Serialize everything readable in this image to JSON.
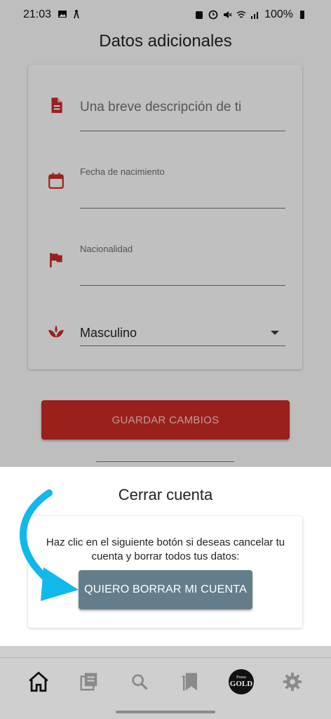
{
  "status_bar": {
    "time": "21:03",
    "battery": "100%",
    "left_icons": [
      "image-icon",
      "accessibility-icon"
    ],
    "right_icons": [
      "alarm-icon",
      "clock-icon",
      "mute-icon",
      "wifi-icon",
      "signal-icon",
      "battery-icon"
    ]
  },
  "additional": {
    "title": "Datos adicionales",
    "description_placeholder": "Una breve descripción de ti",
    "birthdate_label": "Fecha de nacimiento",
    "nationality_label": "Nacionalidad",
    "gender_value": "Masculino",
    "icons": [
      "document-icon",
      "calendar-icon",
      "flag-icon",
      "gender-lotus-icon"
    ]
  },
  "save_button": "GUARDAR CAMBIOS",
  "close_account": {
    "title": "Cerrar cuenta",
    "message": "Haz clic en el siguiente botón si deseas cancelar tu cuenta y borrar todos tus datos:",
    "delete_button": "QUIERO BORRAR MI CUENTA"
  },
  "bottom_nav": {
    "items": [
      "home-icon",
      "library-icon",
      "search-icon",
      "bookmarks-icon",
      "gold-badge",
      "settings-icon"
    ],
    "gold_small": "Puma",
    "gold_big": "GOLD"
  },
  "colors": {
    "accent": "#c62a25",
    "delete_button": "#637e8a",
    "arrow": "#10b8ec"
  }
}
